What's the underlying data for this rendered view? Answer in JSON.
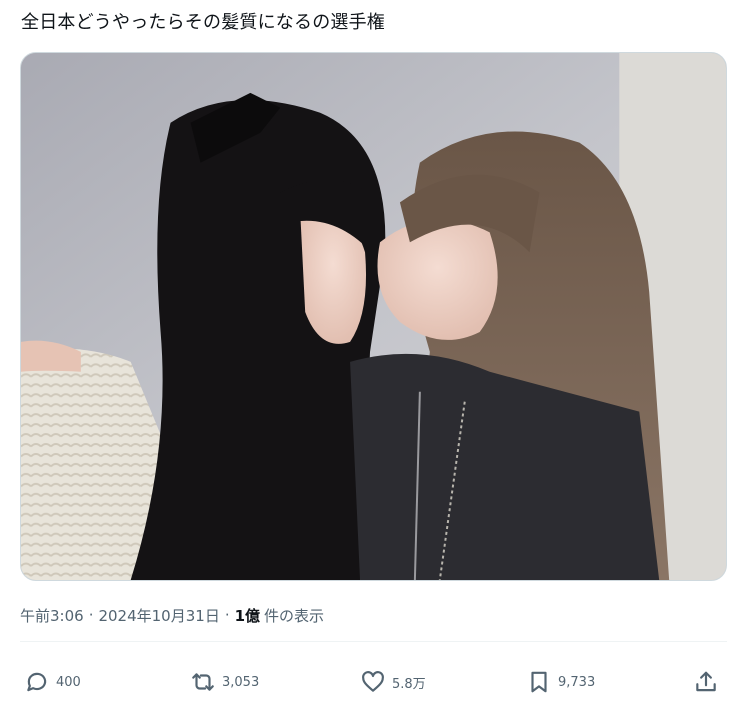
{
  "post": {
    "text": "全日本どうやったらその髪質になるの選手権"
  },
  "media": {
    "alt": "photo"
  },
  "meta": {
    "time": "午前3:06",
    "separator": "·",
    "date": "2024年10月31日",
    "views_count": "1億",
    "views_label": "件の表示"
  },
  "actions": {
    "reply_count": "400",
    "repost_count": "3,053",
    "like_count": "5.8万",
    "bookmark_count": "9,733"
  },
  "icons": {
    "reply": "speech-bubble-icon",
    "repost": "repost-arrows-icon",
    "like": "heart-icon",
    "bookmark": "bookmark-icon",
    "share": "share-upload-icon"
  },
  "colors": {
    "text": "#0f1419",
    "secondary": "#536471",
    "border": "#cfd9de"
  }
}
